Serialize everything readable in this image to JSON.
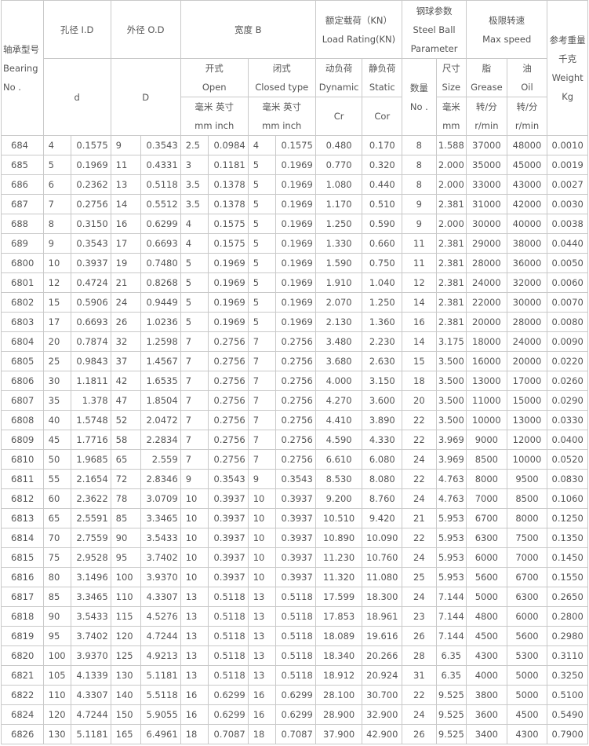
{
  "header": {
    "model": [
      "轴承型号",
      "Bearing",
      "No ."
    ],
    "bore_title": "孔径 I.D",
    "od_title": "外径 O.D",
    "width_title": "宽度 B",
    "load_title": [
      "额定载荷（KN）",
      "Load Rating(KN)"
    ],
    "ball_title": [
      "钢球参数",
      "Steel Ball",
      "Parameter"
    ],
    "speed_title": [
      "极限转速",
      "Max speed"
    ],
    "weight_title": [
      "参考重量",
      "千克",
      "Weight",
      "Kg"
    ],
    "bore_sym": "d",
    "od_sym": "D",
    "open": [
      "开式",
      "Open"
    ],
    "closed": [
      "闭式",
      "Closed type"
    ],
    "dynamic": [
      "动负荷",
      "Dynamic"
    ],
    "static": [
      "静负荷",
      "Static"
    ],
    "ball_num": "数量",
    "ball_no": "No .",
    "ball_size": [
      "尺寸",
      "Size"
    ],
    "grease": [
      "脂",
      "Grease"
    ],
    "oil": [
      "油",
      "Oil"
    ],
    "mm_inch": [
      "毫米 英寸",
      "mm inch"
    ],
    "cr": "Cr",
    "cor": "Cor",
    "size_unit": [
      "毫米",
      "mm"
    ],
    "rpm": [
      "转/分",
      "r/min"
    ]
  },
  "rows": [
    [
      "684",
      "4",
      "0.1575",
      "9",
      "0.3543",
      "2.5",
      "0.0984",
      "4",
      "0.1575",
      "0.480",
      "0.170",
      "8",
      "1.588",
      "37000",
      "48000",
      "0.0010"
    ],
    [
      "685",
      "5",
      "0.1969",
      "11",
      "0.4331",
      "3",
      "0.1181",
      "5",
      "0.1969",
      "0.770",
      "0.320",
      "8",
      "2.000",
      "35000",
      "45000",
      "0.0019"
    ],
    [
      "686",
      "6",
      "0.2362",
      "13",
      "0.5118",
      "3.5",
      "0.1378",
      "5",
      "0.1969",
      "1.080",
      "0.440",
      "8",
      "2.000",
      "33000",
      "43000",
      "0.0027"
    ],
    [
      "687",
      "7",
      "0.2756",
      "14",
      "0.5512",
      "3.5",
      "0.1378",
      "5",
      "0.1969",
      "1.170",
      "0.510",
      "9",
      "2.381",
      "31000",
      "42000",
      "0.0030"
    ],
    [
      "688",
      "8",
      "0.3150",
      "16",
      "0.6299",
      "4",
      "0.1575",
      "5",
      "0.1969",
      "1.250",
      "0.590",
      "9",
      "2.000",
      "30000",
      "40000",
      "0.0038"
    ],
    [
      "689",
      "9",
      "0.3543",
      "17",
      "0.6693",
      "4",
      "0.1575",
      "5",
      "0.1969",
      "1.330",
      "0.660",
      "11",
      "2.381",
      "29000",
      "38000",
      "0.0440"
    ],
    [
      "6800",
      "10",
      "0.3937",
      "19",
      "0.7480",
      "5",
      "0.1969",
      "5",
      "0.1969",
      "1.590",
      "0.750",
      "11",
      "2.381",
      "28000",
      "36000",
      "0.0050"
    ],
    [
      "6801",
      "12",
      "0.4724",
      "21",
      "0.8268",
      "5",
      "0.1969",
      "5",
      "0.1969",
      "1.910",
      "1.040",
      "12",
      "2.381",
      "24000",
      "32000",
      "0.0060"
    ],
    [
      "6802",
      "15",
      "0.5906",
      "24",
      "0.9449",
      "5",
      "0.1969",
      "5",
      "0.1969",
      "2.070",
      "1.250",
      "14",
      "2.381",
      "22000",
      "30000",
      "0.0070"
    ],
    [
      "6803",
      "17",
      "0.6693",
      "26",
      "1.0236",
      "5",
      "0.1969",
      "5",
      "0.1969",
      "2.130",
      "1.360",
      "16",
      "2.381",
      "20000",
      "28000",
      "0.0080"
    ],
    [
      "6804",
      "20",
      "0.7874",
      "32",
      "1.2598",
      "7",
      "0.2756",
      "7",
      "0.2756",
      "3.480",
      "2.230",
      "14",
      "3.175",
      "18000",
      "24000",
      "0.0090"
    ],
    [
      "6805",
      "25",
      "0.9843",
      "37",
      "1.4567",
      "7",
      "0.2756",
      "7",
      "0.2756",
      "3.680",
      "2.630",
      "15",
      "3.500",
      "16000",
      "20000",
      "0.0220"
    ],
    [
      "6806",
      "30",
      "1.1811",
      "42",
      "1.6535",
      "7",
      "0.2756",
      "7",
      "0.2756",
      "4.000",
      "3.150",
      "18",
      "3.500",
      "13000",
      "17000",
      "0.0260"
    ],
    [
      "6807",
      "35",
      "1.378",
      "47",
      "1.8504",
      "7",
      "0.2756",
      "7",
      "0.2756",
      "4.270",
      "3.600",
      "20",
      "3.500",
      "11000",
      "15000",
      "0.0290"
    ],
    [
      "6808",
      "40",
      "1.5748",
      "52",
      "2.0472",
      "7",
      "0.2756",
      "7",
      "0.2756",
      "4.410",
      "3.890",
      "22",
      "3.500",
      "10000",
      "13000",
      "0.0330"
    ],
    [
      "6809",
      "45",
      "1.7716",
      "58",
      "2.2834",
      "7",
      "0.2756",
      "7",
      "0.2756",
      "4.590",
      "4.330",
      "22",
      "3.969",
      "9000",
      "12000",
      "0.0400"
    ],
    [
      "6810",
      "50",
      "1.9685",
      "65",
      "2.559",
      "7",
      "0.2756",
      "7",
      "0.2756",
      "6.610",
      "6.080",
      "24",
      "3.969",
      "8500",
      "10000",
      "0.0520"
    ],
    [
      "6811",
      "55",
      "2.1654",
      "72",
      "2.8346",
      "9",
      "0.3543",
      "9",
      "0.3543",
      "8.530",
      "8.080",
      "22",
      "4.763",
      "8000",
      "9500",
      "0.0830"
    ],
    [
      "6812",
      "60",
      "2.3622",
      "78",
      "3.0709",
      "10",
      "0.3937",
      "10",
      "0.3937",
      "9.200",
      "8.760",
      "24",
      "4.763",
      "7000",
      "8500",
      "0.1060"
    ],
    [
      "6813",
      "65",
      "2.5591",
      "85",
      "3.3465",
      "10",
      "0.3937",
      "10",
      "0.3937",
      "10.510",
      "9.420",
      "21",
      "5.953",
      "6700",
      "8000",
      "0.1250"
    ],
    [
      "6814",
      "70",
      "2.7559",
      "90",
      "3.5433",
      "10",
      "0.3937",
      "10",
      "0.3937",
      "10.890",
      "10.090",
      "22",
      "5.953",
      "6300",
      "7500",
      "0.1350"
    ],
    [
      "6815",
      "75",
      "2.9528",
      "95",
      "3.7402",
      "10",
      "0.3937",
      "10",
      "0.3937",
      "11.230",
      "10.760",
      "24",
      "5.953",
      "6000",
      "7000",
      "0.1450"
    ],
    [
      "6816",
      "80",
      "3.1496",
      "100",
      "3.9370",
      "10",
      "0.3937",
      "10",
      "0.3937",
      "11.320",
      "11.080",
      "25",
      "5.953",
      "5600",
      "6700",
      "0.1550"
    ],
    [
      "6817",
      "85",
      "3.3465",
      "110",
      "4.3307",
      "13",
      "0.5118",
      "13",
      "0.5118",
      "17.599",
      "18.300",
      "24",
      "7.144",
      "5000",
      "6300",
      "0.2650"
    ],
    [
      "6818",
      "90",
      "3.5433",
      "115",
      "4.5276",
      "13",
      "0.5118",
      "13",
      "0.5118",
      "17.853",
      "18.961",
      "23",
      "7.144",
      "4800",
      "6000",
      "0.2800"
    ],
    [
      "6819",
      "95",
      "3.7402",
      "120",
      "4.7244",
      "13",
      "0.5118",
      "13",
      "0.5118",
      "18.089",
      "19.616",
      "26",
      "7.144",
      "4500",
      "5600",
      "0.2980"
    ],
    [
      "6820",
      "100",
      "3.9370",
      "125",
      "4.9213",
      "13",
      "0.5118",
      "13",
      "0.5118",
      "18.340",
      "20.266",
      "28",
      "6.35",
      "4300",
      "5300",
      "0.3110"
    ],
    [
      "6821",
      "105",
      "4.1339",
      "130",
      "5.1181",
      "13",
      "0.5118",
      "13",
      "0.5118",
      "18.912",
      "20.924",
      "31",
      "6.35",
      "4000",
      "5000",
      "0.3250"
    ],
    [
      "6822",
      "110",
      "4.3307",
      "140",
      "5.5118",
      "16",
      "0.6299",
      "16",
      "0.6299",
      "28.100",
      "30.700",
      "22",
      "9.525",
      "3800",
      "5000",
      "0.5100"
    ],
    [
      "6824",
      "120",
      "4.7244",
      "150",
      "5.9055",
      "16",
      "0.6299",
      "16",
      "0.6299",
      "28.900",
      "32.900",
      "24",
      "9.525",
      "3600",
      "4500",
      "0.5490"
    ],
    [
      "6826",
      "130",
      "5.1181",
      "165",
      "6.4961",
      "18",
      "0.7087",
      "18",
      "0.7087",
      "37.900",
      "42.900",
      "26",
      "9.525",
      "3400",
      "4300",
      "0.7900"
    ]
  ]
}
